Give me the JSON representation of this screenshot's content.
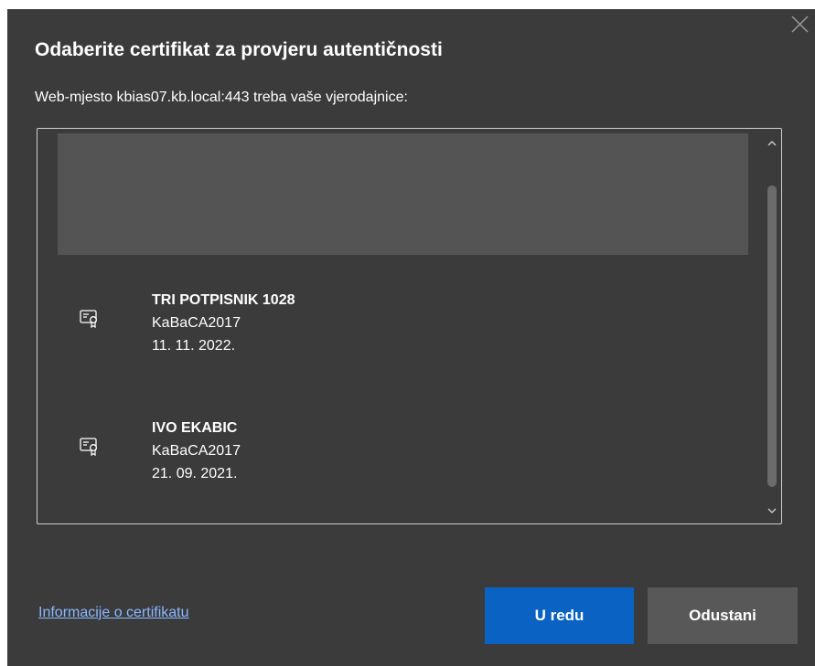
{
  "dialog": {
    "title": "Odaberite certifikat za provjeru autentičnosti",
    "subtitle": "Web-mjesto kbias07.kb.local:443 treba vaše vjerodajnice:"
  },
  "certificates": [
    {
      "name": "TRI POTPISNIK 1028",
      "issuer": "KaBaCA2017",
      "date": "11. 11. 2022.",
      "icon": "certificate-icon"
    },
    {
      "name": "IVO EKABIC",
      "issuer": "KaBaCA2017",
      "date": "21. 09. 2021.",
      "icon": "certificate-icon"
    }
  ],
  "footer": {
    "info_link": "Informacije o certifikatu",
    "ok_label": "U redu",
    "cancel_label": "Odustani"
  },
  "colors": {
    "dialog_bg": "#3b3b3b",
    "selected_item_bg": "#545454",
    "primary_button": "#0a63c2",
    "secondary_button": "#585858",
    "link": "#8ab8ff"
  }
}
